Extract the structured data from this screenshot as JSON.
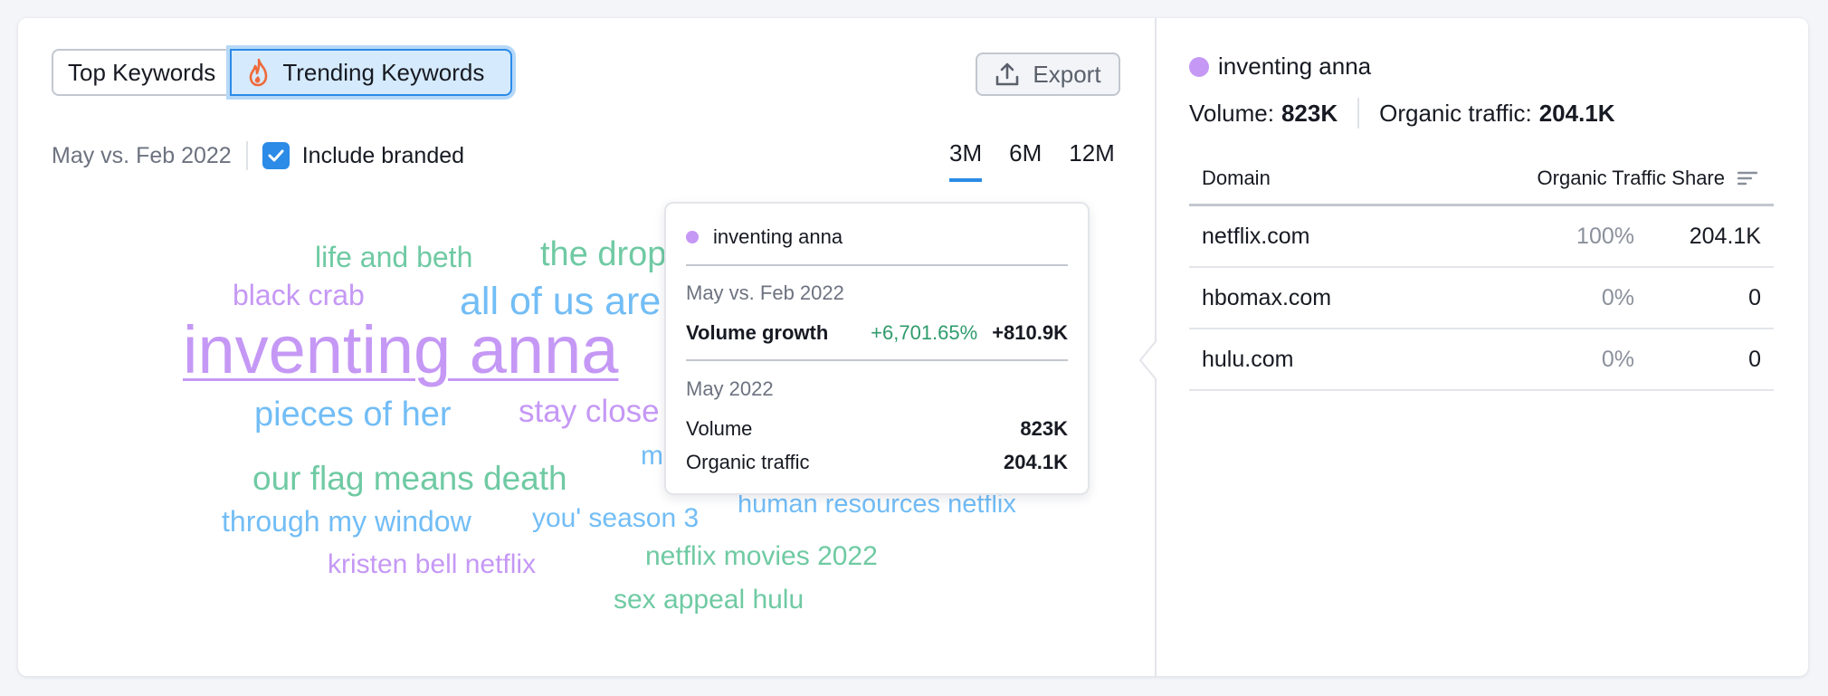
{
  "tabs": {
    "top_keywords": "Top Keywords",
    "trending_keywords": "Trending Keywords"
  },
  "export_label": "Export",
  "filters": {
    "date_label": "May vs. Feb 2022",
    "include_branded": "Include branded",
    "include_branded_checked": true
  },
  "periods": [
    "3M",
    "6M",
    "12M"
  ],
  "active_period": "3M",
  "word_cloud": {
    "life_and_beth": "life and beth",
    "the_drop": "the drop",
    "black_crab": "black crab",
    "all_of_us_are": "all of us are",
    "inventing_anna": "inventing anna",
    "pieces_of_her": "pieces of her",
    "stay_close": "stay close",
    "m_partial": "m",
    "our_flag": "our flag means death",
    "human_resources": "human resources netflix",
    "through_my_window": "through my window",
    "you_season_3": "you' season 3",
    "netflix_movies_2022": "netflix movies 2022",
    "kristen_bell": "kristen bell netflix",
    "sex_appeal": "sex appeal hulu"
  },
  "tooltip": {
    "keyword": "inventing anna",
    "period_label": "May vs. Feb 2022",
    "volume_growth_label": "Volume growth",
    "volume_growth_pct": "+6,701.65%",
    "volume_growth_abs": "+810.9K",
    "month_label": "May 2022",
    "volume_label": "Volume",
    "volume_value": "823K",
    "organic_label": "Organic traffic",
    "organic_value": "204.1K"
  },
  "detail": {
    "keyword": "inventing anna",
    "volume_label": "Volume:",
    "volume_value": "823K",
    "organic_label": "Organic traffic:",
    "organic_value": "204.1K",
    "columns": {
      "domain": "Domain",
      "share": "Organic Traffic Share"
    },
    "rows": [
      {
        "domain": "netflix.com",
        "share": "100%",
        "traffic": "204.1K"
      },
      {
        "domain": "hbomax.com",
        "share": "0%",
        "traffic": "0"
      },
      {
        "domain": "hulu.com",
        "share": "0%",
        "traffic": "0"
      }
    ]
  },
  "colors": {
    "accent": "#2b8be6",
    "purple": "#c598f5",
    "green": "#6fcaa3",
    "blue": "#72bdf6",
    "flame": "#ef6a3a"
  }
}
